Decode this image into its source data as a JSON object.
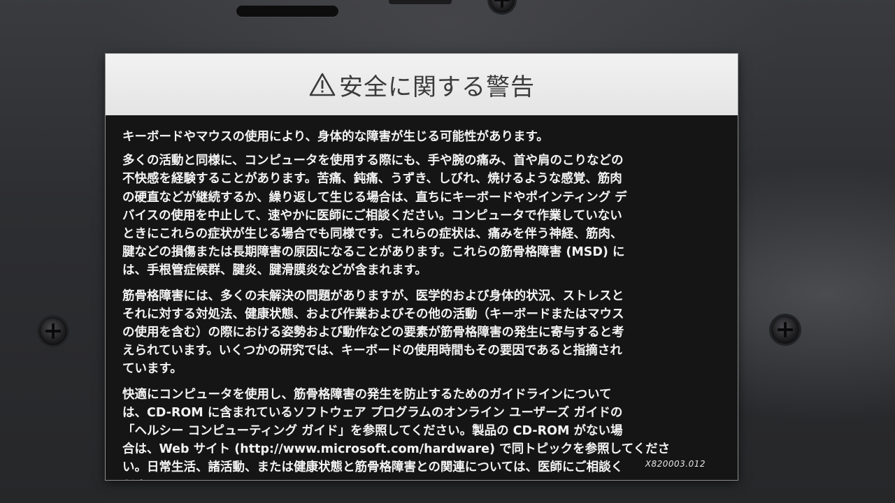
{
  "label": {
    "title": "安全に関する警告",
    "lead": "キーボードやマウスの使用により、身体的な障害が生じる可能性があります。",
    "paragraphs": [
      "多くの活動と同様に、コンピュータを使用する際にも、手や腕の痛み、首や肩のこりなどの\n不快感を経験することがあります。苦痛、鈍痛、うずき、しびれ、焼けるような感覚、筋肉\nの硬直などが継続するか、繰り返して生じる場合は、直ちにキーボードやポインティング デ\nバイスの使用を中止して、速やかに医師にご相談ください。コンピュータで作業していない\nときにこれらの症状が生じる場合でも同様です。これらの症状は、痛みを伴う神経、筋肉、\n腱などの損傷または長期障害の原因になることがあります。これらの筋骨格障害 (MSD) に\nは、手根管症候群、腱炎、腱滑膜炎などが含まれます。",
      "筋骨格障害には、多くの未解決の問題がありますが、医学的および身体的状況、ストレスと\nそれに対する対処法、健康状態、および作業およびその他の活動（キーボードまたはマウス\nの使用を含む）の際における姿勢および動作などの要素が筋骨格障害の発生に寄与すると考\nえられています。いくつかの研究では、キーボードの使用時間もその要因であると指摘され\nています。",
      "快適にコンピュータを使用し、筋骨格障害の発生を防止するためのガイドラインについて\nは、CD-ROM に含まれているソフトウェア プログラムのオンライン ユーザーズ ガイドの\n「ヘルシー コンピューティング ガイド」を参照してください。製品の CD-ROM がない場\n合は、Web サイト (http://www.microsoft.com/hardware) で同トピックを参照してくださ\nい。日常生活、諸活動、または健康状態と筋骨格障害との関連については、医師にご相談く\nださい。"
    ],
    "doc_code": "X820003.012"
  },
  "icons": {
    "warning": "warning-triangle-icon"
  },
  "colors": {
    "label_background": "#151515",
    "header_background": "#e8e8e8",
    "text": "#f4f4f4",
    "device_body": "#2d2e31"
  }
}
